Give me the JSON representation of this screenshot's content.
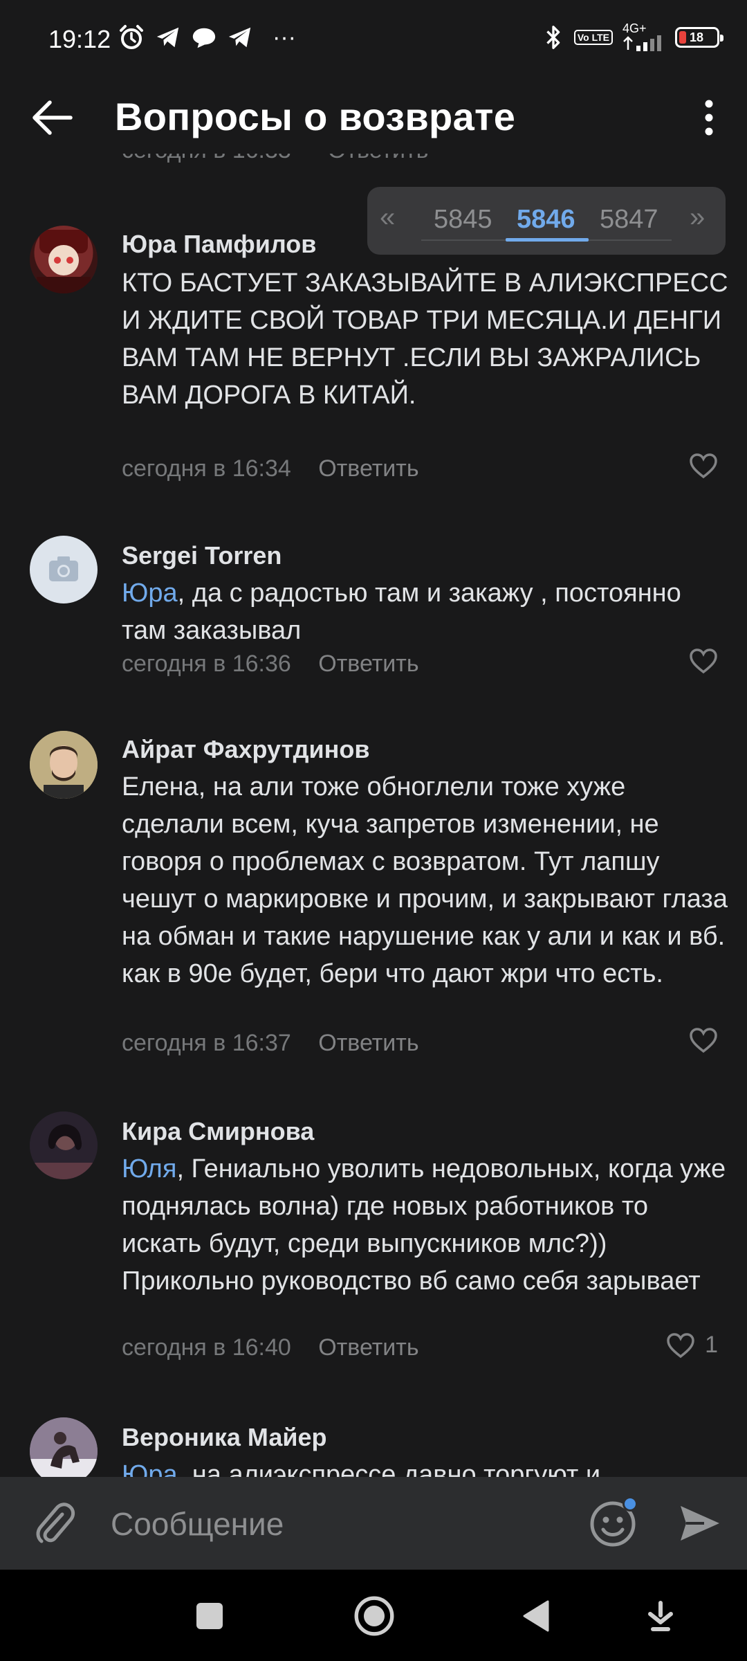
{
  "status_bar": {
    "time": "19:12",
    "left_icons": [
      "alarm-icon",
      "telegram-icon",
      "chat-bubble-icon",
      "telegram-icon"
    ],
    "overflow": "···",
    "volte": "Vo LTE",
    "network": "4G+",
    "battery": "18",
    "battery_color": "#e8423c"
  },
  "appbar": {
    "title": "Вопросы о возврате"
  },
  "cut_line": {
    "time": "сегодня в 16:33",
    "reply": "Ответить"
  },
  "pager": {
    "prev_arrow": "«",
    "next_arrow": "»",
    "pages": [
      "5845",
      "5846",
      "5847"
    ],
    "active_page": "5846"
  },
  "comments": [
    {
      "author": "Юра Памфилов",
      "mention": "",
      "text": "КТО БАСТУЕТ ЗАКАЗЫВАЙТЕ В АЛИЭКСПРЕСС И ЖДИТЕ СВОЙ ТОВАР ТРИ МЕСЯЦА.И ДЕНГИ ВАМ ТАМ НЕ ВЕРНУТ .ЕСЛИ ВЫ ЗАЖРАЛИСЬ ВАМ ДОРОГА В КИТАЙ.",
      "time": "сегодня в 16:34",
      "reply": "Ответить",
      "likes": ""
    },
    {
      "author": "Sergei Torren",
      "mention": "Юра",
      "text": ", да с радостью там и закажу , постоянно там заказывал",
      "time": "сегодня в 16:36",
      "reply": "Ответить",
      "likes": ""
    },
    {
      "author": "Айрат Фахрутдинов",
      "mention": "",
      "text": "Елена, на али тоже обноглели тоже хуже сделали всем, куча запретов изменении, не говоря о проблемах с возвратом. Тут лапшу чешут о маркировке и прочим, и закрывают глаза на обман и такие нарушение как у али и как и вб. как в 90е будет, бери что дают жри что есть.",
      "time": "сегодня в 16:37",
      "reply": "Ответить",
      "likes": ""
    },
    {
      "author": "Кира Смирнова",
      "mention": "Юля",
      "text": ", Гениально уволить недовольных, когда уже поднялась волна) где новых работников то искать будут, среди выпускников млс?)) Прикольно руководство вб само себя зарывает",
      "time": "сегодня в 16:40",
      "reply": "Ответить",
      "likes": "1"
    },
    {
      "author": "Вероника Майер",
      "mention": "Юра",
      "text": ", на алиэкспрессе давно торгуют и",
      "time": "",
      "reply": "",
      "likes": ""
    }
  ],
  "composer": {
    "placeholder": "Сообщение"
  },
  "colors": {
    "background": "#19191a",
    "accent": "#71aaeb",
    "secondary_text": "#76787a",
    "composer_bg": "#2c2d2f"
  }
}
